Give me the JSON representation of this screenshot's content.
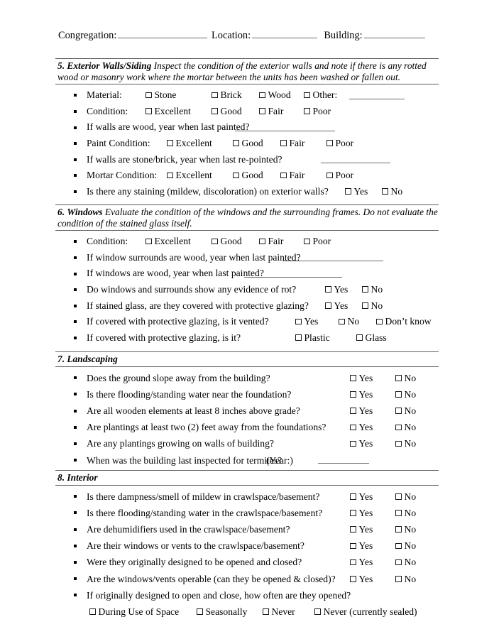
{
  "header": {
    "congregation_label": "Congregation:",
    "location_label": "Location:",
    "building_label": "Building:",
    "congregation_value": "",
    "location_value": "",
    "building_value": ""
  },
  "sections": [
    {
      "number": "5.",
      "title": "Exterior Walls/Siding",
      "description": "Inspect the condition of the exterior walls and note if there is any rotted wood or masonry work where the mortar between the units has been washed or fallen out.",
      "rows": [
        {
          "label": "Material:",
          "options": [
            "Stone",
            "Brick",
            "Wood",
            "Other:"
          ],
          "trailing_blank": true
        },
        {
          "label": "Condition:",
          "options": [
            "Excellent",
            "Good",
            "Fair",
            "Poor"
          ]
        },
        {
          "label": "If walls are wood, year when last painted?",
          "options": [],
          "trailing_blank": true
        },
        {
          "label": "Paint Condition:",
          "options": [
            "Excellent",
            "Good",
            "Fair",
            "Poor"
          ]
        },
        {
          "label": "If walls are stone/brick, year when last re-pointed?",
          "options": [],
          "trailing_blank": true
        },
        {
          "label": "Mortar Condition:",
          "options": [
            "Excellent",
            "Good",
            "Fair",
            "Poor"
          ]
        },
        {
          "label": "Is there any staining (mildew, discoloration) on exterior walls?",
          "options": [
            "Yes",
            "No"
          ]
        }
      ]
    },
    {
      "number": "6.",
      "title": "Windows",
      "description": "Evaluate the condition of the windows and the surrounding frames.  Do not evaluate the condition of the stained glass itself.",
      "rows": [
        {
          "label": "Condition:",
          "options": [
            "Excellent",
            "Good",
            "Fair",
            "Poor"
          ]
        },
        {
          "label": "If window surrounds are wood, year when last painted?",
          "options": [],
          "trailing_blank": true
        },
        {
          "label": "If windows are wood, year when last painted?",
          "options": [],
          "trailing_blank": true
        },
        {
          "label": "Do windows and surrounds show any evidence of rot?",
          "options": [
            "Yes",
            "No"
          ]
        },
        {
          "label": "If stained glass, are they covered with protective glazing?",
          "options": [
            "Yes",
            "No"
          ]
        },
        {
          "label": "If covered with protective glazing, is it vented?",
          "options": [
            "Yes",
            "No",
            "Don’t know"
          ]
        },
        {
          "label": "If covered with protective glazing, is it?",
          "options": [
            "Plastic",
            "Glass"
          ]
        }
      ]
    },
    {
      "number": "7.",
      "title": "Landscaping",
      "description": "",
      "rows": [
        {
          "label": "Does the ground slope away from the building?",
          "options": [
            "Yes",
            "No"
          ]
        },
        {
          "label": "Is there flooding/standing water near the foundation?",
          "options": [
            "Yes",
            "No"
          ]
        },
        {
          "label": "Are all wooden elements at least 8 inches above grade?",
          "options": [
            "Yes",
            "No"
          ]
        },
        {
          "label": "Are plantings at least two (2) feet away from the foundations?",
          "options": [
            "Yes",
            "No"
          ]
        },
        {
          "label": "Are any plantings growing on walls of building?",
          "options": [
            "Yes",
            "No"
          ]
        },
        {
          "label": "When was the building last inspected for termites?",
          "options": [],
          "year_label": "(Year:)",
          "trailing_blank": true
        }
      ]
    },
    {
      "number": "8.",
      "title": "Interior",
      "description": "",
      "rows": [
        {
          "label": "Is there dampness/smell of mildew in crawlspace/basement?",
          "options": [
            "Yes",
            "No"
          ]
        },
        {
          "label": "Is there flooding/standing water in the crawlspace/basement?",
          "options": [
            "Yes",
            "No"
          ]
        },
        {
          "label": "Are dehumidifiers used in the crawlspace/basement?",
          "options": [
            "Yes",
            "No"
          ]
        },
        {
          "label": "Are their windows or vents to the crawlspace/basement?",
          "options": [
            "Yes",
            "No"
          ]
        },
        {
          "label": "Were they originally designed to be opened and closed?",
          "options": [
            "Yes",
            "No"
          ]
        },
        {
          "label": "Are the windows/vents operable (can they be opened & closed)?",
          "options": [
            "Yes",
            "No"
          ]
        },
        {
          "label": "If originally designed to open and close, how often are they opened?",
          "options": []
        }
      ],
      "sub_options": [
        "During Use of Space",
        "Seasonally",
        "Never",
        "Never (currently sealed)"
      ]
    }
  ]
}
